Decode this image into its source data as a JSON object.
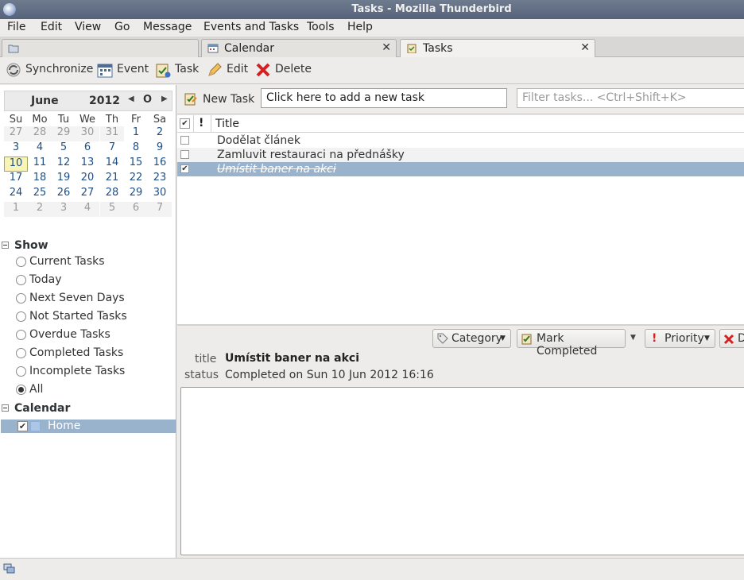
{
  "window": {
    "title": "Tasks - Mozilla Thunderbird"
  },
  "menu": [
    "File",
    "Edit",
    "View",
    "Go",
    "Message",
    "Events and Tasks",
    "Tools",
    "Help"
  ],
  "tabs": [
    {
      "label": ""
    },
    {
      "label": "Calendar"
    },
    {
      "label": "Tasks"
    }
  ],
  "toolbar": {
    "synchronize": "Synchronize",
    "event": "Event",
    "task": "Task",
    "edit": "Edit",
    "delete": "Delete"
  },
  "minical": {
    "month": "June",
    "year": "2012",
    "today_glyph": "O",
    "day_names": [
      "Su",
      "Mo",
      "Tu",
      "We",
      "Th",
      "Fr",
      "Sa"
    ],
    "weeks": [
      [
        "27",
        "28",
        "29",
        "30",
        "31",
        "1",
        "2"
      ],
      [
        "3",
        "4",
        "5",
        "6",
        "7",
        "8",
        "9"
      ],
      [
        "10",
        "11",
        "12",
        "13",
        "14",
        "15",
        "16"
      ],
      [
        "17",
        "18",
        "19",
        "20",
        "21",
        "22",
        "23"
      ],
      [
        "24",
        "25",
        "26",
        "27",
        "28",
        "29",
        "30"
      ],
      [
        "1",
        "2",
        "3",
        "4",
        "5",
        "6",
        "7"
      ]
    ]
  },
  "filters": {
    "heading": "Show",
    "options": [
      "Current Tasks",
      "Today",
      "Next Seven Days",
      "Not Started Tasks",
      "Overdue Tasks",
      "Completed Tasks",
      "Incomplete Tasks",
      "All"
    ],
    "selected": "All"
  },
  "calendars": {
    "heading": "Calendar",
    "items": [
      {
        "name": "Home",
        "checked": true
      }
    ]
  },
  "task_bar": {
    "new_task": "New Task",
    "quick_add": "Click here to add a new task",
    "filter_placeholder": "Filter tasks... <Ctrl+Shift+K>"
  },
  "task_list": {
    "header": {
      "title": "Title",
      "priority": "!"
    },
    "tasks": [
      {
        "title": "Dodělat článek",
        "completed": false
      },
      {
        "title": "Zamluvit restauraci na přednášky",
        "completed": false
      },
      {
        "title": "Umístit baner na akci",
        "completed": true
      }
    ]
  },
  "details": {
    "buttons": {
      "category": "Category",
      "mark_completed": "Mark Completed",
      "priority": "Priority",
      "delete": "D"
    },
    "title_label": "title",
    "title_value": "Umístit baner na akci",
    "status_label": "status",
    "status_value": "Completed on Sun 10 Jun 2012 16:16"
  },
  "colors": {
    "selection": "#99b3cd",
    "today_bg": "#f8f4b7",
    "link_day": "#1d4f86"
  }
}
